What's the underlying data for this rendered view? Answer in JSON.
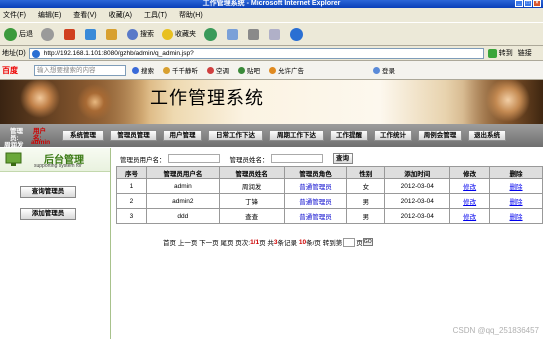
{
  "window": {
    "title": "工作管理系统 - Microsoft Internet Explorer"
  },
  "menu": [
    "文件(F)",
    "编辑(E)",
    "查看(V)",
    "收藏(A)",
    "工具(T)",
    "帮助(H)"
  ],
  "toolbar": {
    "back": "后退",
    "search": "搜索",
    "favorites": "收藏夹"
  },
  "address": {
    "label": "地址(D)",
    "url": "http://192.168.1.101:8080/gzhb/admin/q_admin.jsp?",
    "go": "转到",
    "links": "链接"
  },
  "searchbar": {
    "logo": "百度",
    "placeholder": "输入想要搜索的内容",
    "items": [
      "搜索",
      "千千静听",
      "空调",
      "贴吧",
      "允许广告",
      "登录"
    ]
  },
  "banner": {
    "title": "工作管理系统"
  },
  "user": {
    "label1": "管理",
    "value1": "用户",
    "label2": "员:",
    "value2": "名:",
    "name": "周润发",
    "account": "admin"
  },
  "nav": [
    "系统管理",
    "管理员管理",
    "用户管理",
    "日常工作下达",
    "周期工作下达",
    "工作提醒",
    "工作统计",
    "周例会管理",
    "退出系统"
  ],
  "sidebar": {
    "title": "后台管理",
    "subtitle": "supporting system for",
    "buttons": [
      "查询管理员",
      "添加管理员"
    ]
  },
  "query": {
    "label_user": "管理员用户名：",
    "label_name": "管理员姓名：",
    "button": "查询"
  },
  "table": {
    "headers": [
      "序号",
      "管理员用户名",
      "管理员姓名",
      "管理员角色",
      "性别",
      "添加时间",
      "修改",
      "删除"
    ],
    "rows": [
      {
        "no": "1",
        "user": "admin",
        "name": "周润发",
        "role": "普通管理员",
        "sex": "女",
        "date": "2012-03-04",
        "edit": "修改",
        "del": "删除"
      },
      {
        "no": "2",
        "user": "admin2",
        "name": "丁锋",
        "role": "普通管理员",
        "sex": "男",
        "date": "2012-03-04",
        "edit": "修改",
        "del": "删除"
      },
      {
        "no": "3",
        "user": "ddd",
        "name": "查查",
        "role": "普通管理员",
        "sex": "男",
        "date": "2012-03-04",
        "edit": "修改",
        "del": "删除"
      }
    ]
  },
  "pager": {
    "first": "首页",
    "prev": "上一页",
    "next": "下一页",
    "last": "尾页",
    "page_label": "页次:",
    "page": "1/1",
    "page_unit": "页",
    "total_prefix": "共",
    "total": "3",
    "total_suffix": "条记录",
    "per": "10",
    "per_suffix": "条/页",
    "goto": "转到第",
    "goto_suffix": "页",
    "go": "GO"
  },
  "watermark": "CSDN @qq_251836457"
}
